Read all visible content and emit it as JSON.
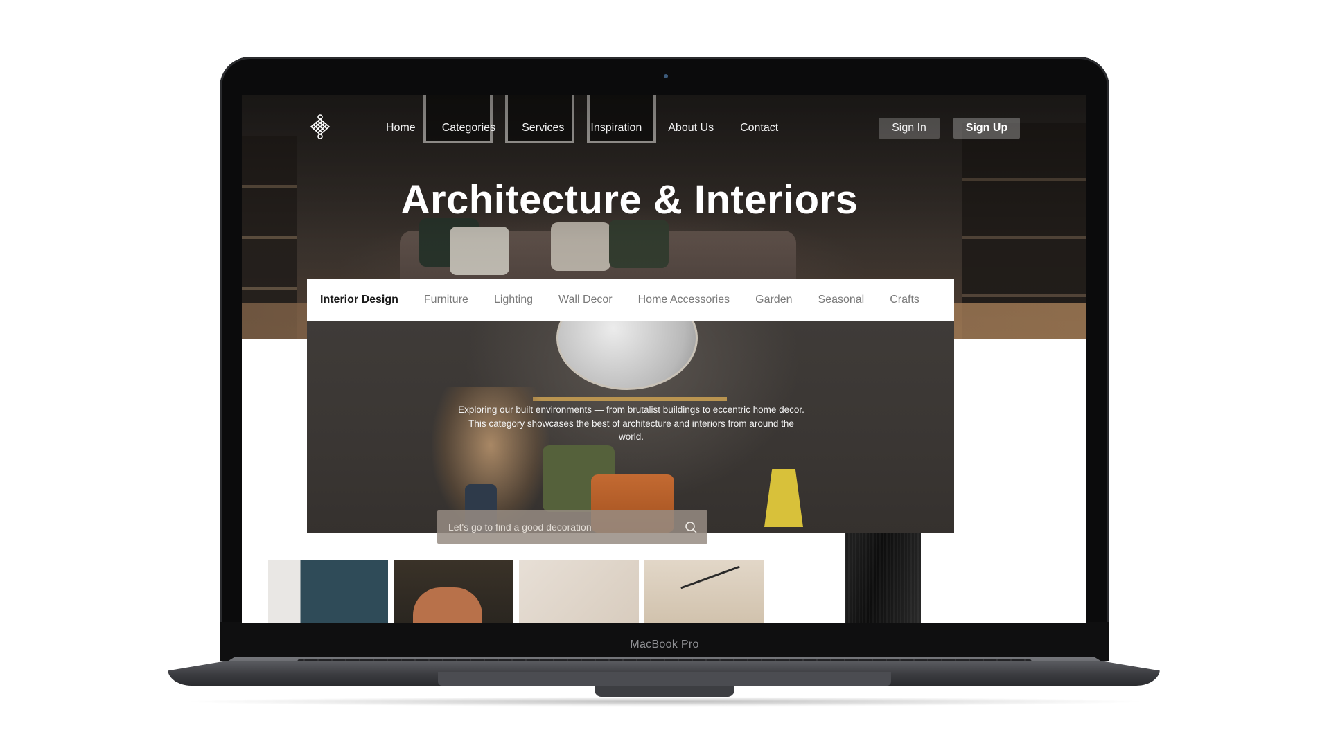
{
  "device": {
    "label": "MacBook Pro"
  },
  "nav": {
    "links": [
      "Home",
      "Categories",
      "Services",
      "Inspiration",
      "About Us",
      "Contact"
    ],
    "sign_in": "Sign In",
    "sign_up": "Sign Up"
  },
  "hero": {
    "title": "Architecture & Interiors"
  },
  "categories": {
    "active": "Interior Design",
    "items": [
      "Interior Design",
      "Furniture",
      "Lighting",
      "Wall Decor",
      "Home Accessories",
      "Garden",
      "Seasonal",
      "Crafts"
    ]
  },
  "feature": {
    "description": "Exploring our built environments — from brutalist buildings to eccentric home decor. This category showcases the best of architecture and interiors from around the world."
  },
  "search": {
    "placeholder": "Let's go to find a good decoration"
  },
  "icons": {
    "logo": "knot-logo-icon",
    "search": "search-icon"
  }
}
